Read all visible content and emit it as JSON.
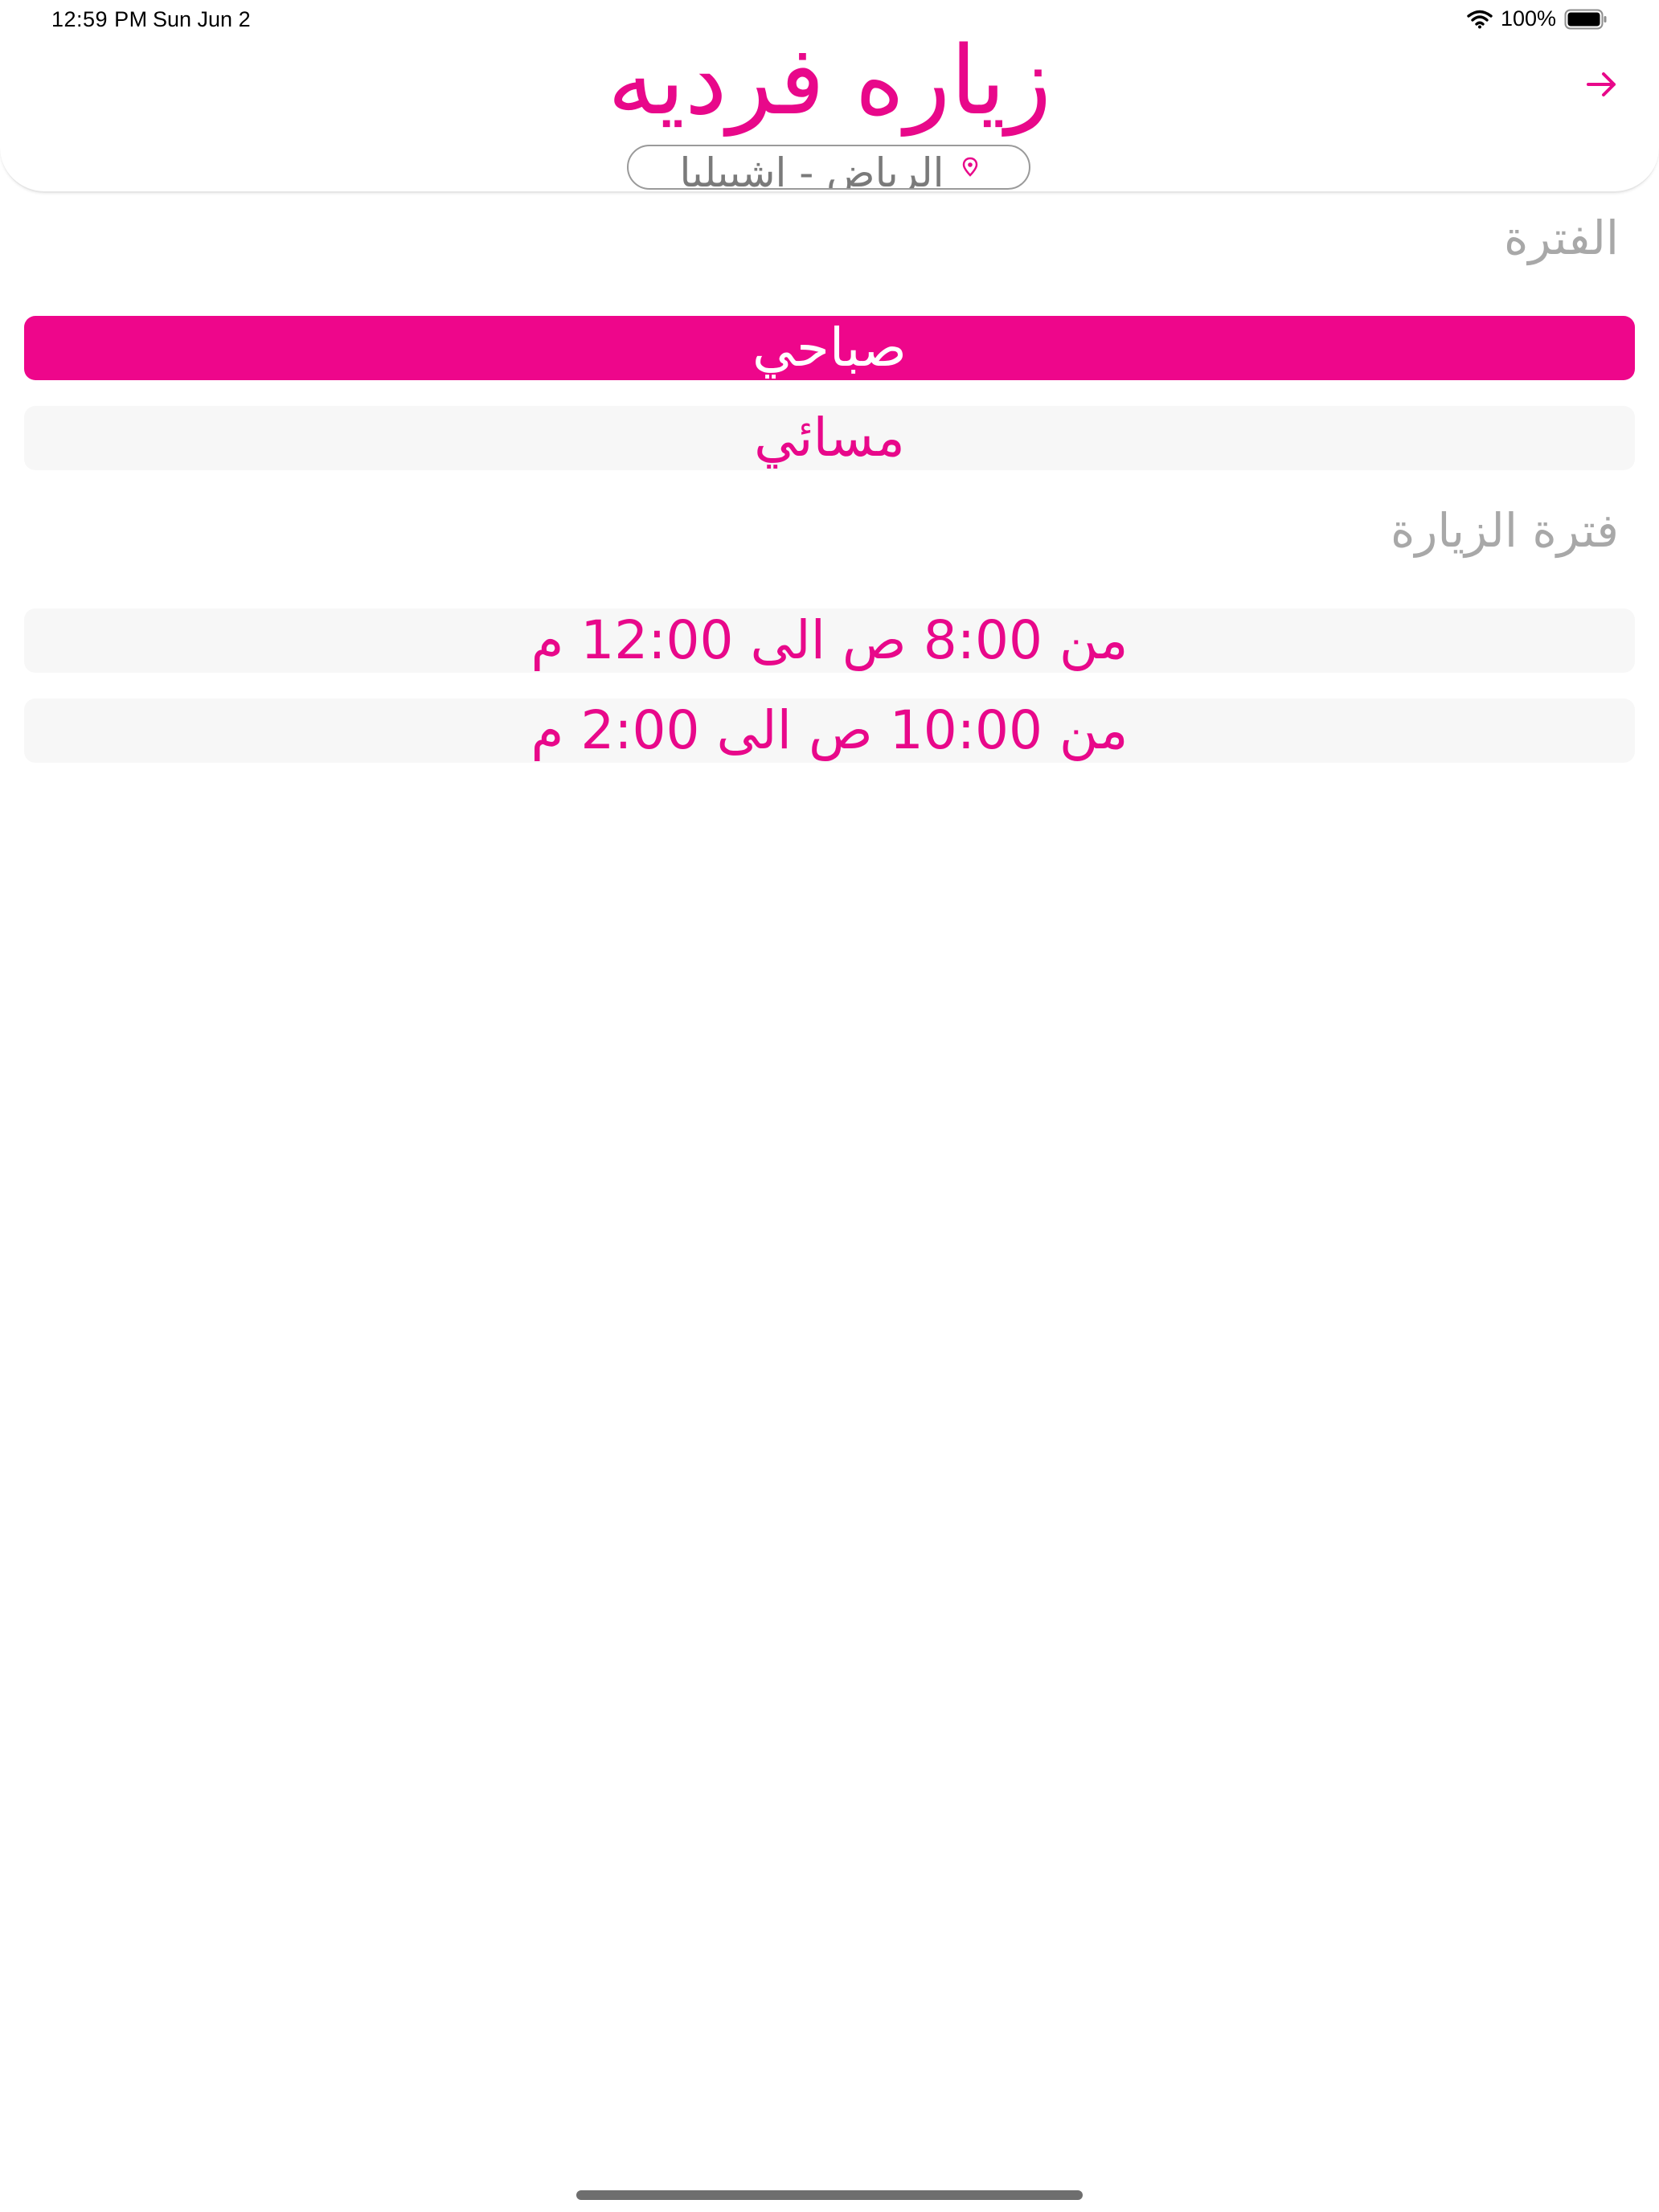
{
  "status_bar": {
    "time": "12:59 PM",
    "date": "Sun Jun 2",
    "battery": "100%"
  },
  "header": {
    "title": "زياره فرديه",
    "location": "الرياض - اشبيليا"
  },
  "period_section": {
    "label": "الفترة",
    "options": [
      {
        "label": "صباحي",
        "selected": true
      },
      {
        "label": "مسائي",
        "selected": false
      }
    ]
  },
  "visit_period_section": {
    "label": "فترة الزيارة",
    "options": [
      {
        "label": "من 8:00 ص الى 12:00 م"
      },
      {
        "label": "من 10:00 ص الى 2:00 م"
      }
    ]
  },
  "colors": {
    "accent": "#EE068B",
    "muted_text": "#A8A8A8",
    "option_background": "#F7F7F7"
  },
  "icons": {
    "back": "arrow-right-icon",
    "location": "map-pin-icon",
    "wifi": "wifi-icon",
    "battery": "battery-icon"
  }
}
